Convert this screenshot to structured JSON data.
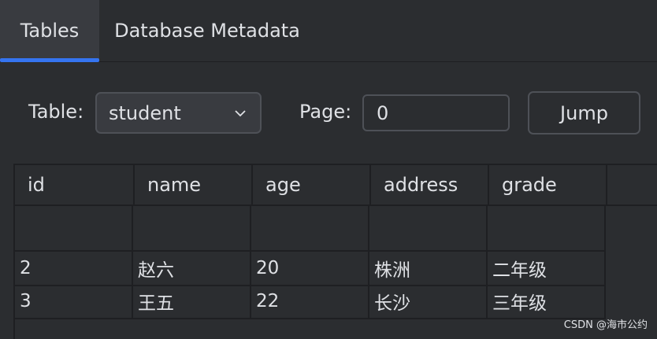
{
  "tabs": [
    {
      "label": "Tables",
      "active": true
    },
    {
      "label": "Database Metadata",
      "active": false
    }
  ],
  "toolbar": {
    "table_label": "Table:",
    "table_value": "student",
    "page_label": "Page:",
    "page_value": "0",
    "jump_label": "Jump"
  },
  "table": {
    "columns": [
      "id",
      "name",
      "age",
      "address",
      "grade"
    ],
    "rows": [
      [
        "",
        "",
        "",
        "",
        ""
      ],
      [
        "2",
        "赵六",
        "20",
        "株洲",
        "二年级"
      ],
      [
        "3",
        "王五",
        "22",
        "长沙",
        "三年级"
      ]
    ]
  },
  "watermark": "CSDN @海市公约",
  "colors": {
    "background": "#2b2d30",
    "accent": "#3574f0",
    "border": "#4e5157"
  }
}
